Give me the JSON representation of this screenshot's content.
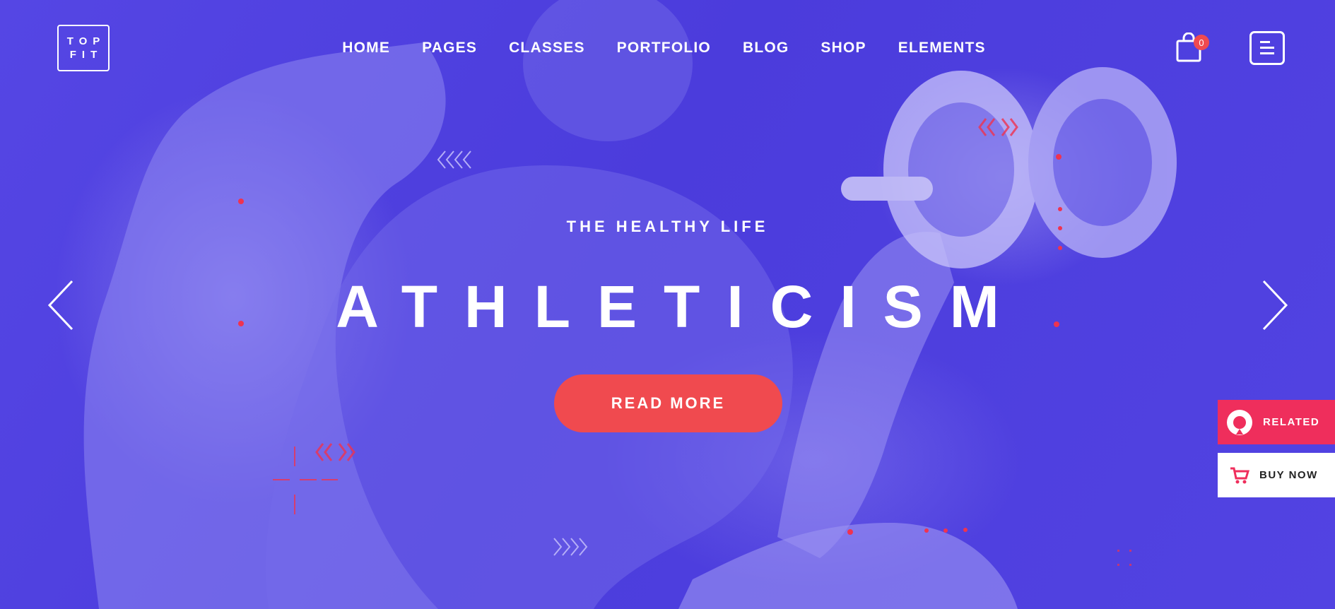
{
  "logo": {
    "line1": "TOP",
    "line2": "FIT"
  },
  "nav": {
    "items": [
      {
        "label": "HOME"
      },
      {
        "label": "PAGES"
      },
      {
        "label": "CLASSES"
      },
      {
        "label": "PORTFOLIO"
      },
      {
        "label": "BLOG"
      },
      {
        "label": "SHOP"
      },
      {
        "label": "ELEMENTS"
      }
    ]
  },
  "header": {
    "cart_count": "0",
    "cart_icon": "shopping-bag-icon",
    "menu_icon": "menu-icon"
  },
  "hero": {
    "subtitle": "THE HEALTHY LIFE",
    "title": "ATHLETICISM",
    "cta_label": "READ MORE",
    "prev_icon": "chevron-left-icon",
    "next_icon": "chevron-right-icon"
  },
  "side_widgets": {
    "related_label": "RELATED",
    "buy_label": "BUY NOW"
  },
  "colors": {
    "background": "#4f3fe0",
    "accent": "#f04a4f",
    "related": "#ef2e5c"
  }
}
